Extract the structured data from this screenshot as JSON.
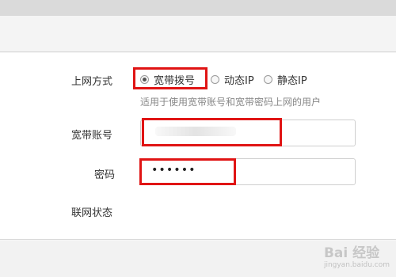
{
  "form": {
    "connection_type_label": "上网方式",
    "options": [
      {
        "label": "宽带拨号",
        "selected": true
      },
      {
        "label": "动态IP",
        "selected": false
      },
      {
        "label": "静态IP",
        "selected": false
      }
    ],
    "hint": "适用于使用宽带账号和宽带密码上网的用户",
    "account_label": "宽带账号",
    "account_value": "",
    "password_label": "密码",
    "password_value": "••••••",
    "status_label": "联网状态"
  },
  "watermark": {
    "text": "Bai 经验",
    "sub": "jingyan.baidu.com"
  },
  "colors": {
    "highlight": "#e01414"
  }
}
